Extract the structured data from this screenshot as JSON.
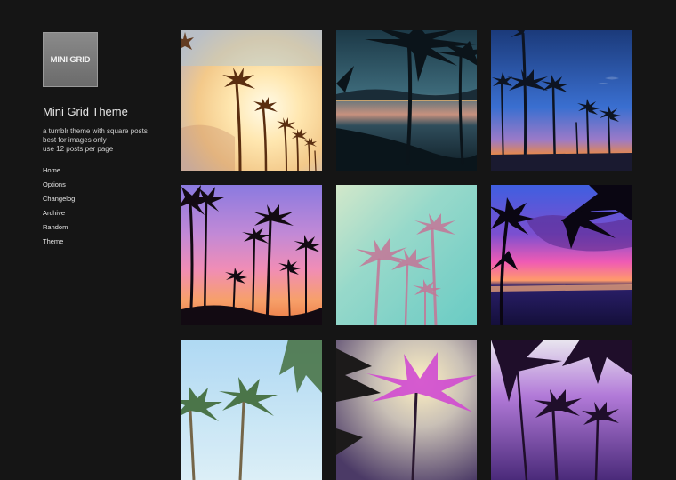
{
  "sidebar": {
    "logo_text": "MINI GRID",
    "title": "Mini Grid Theme",
    "description": [
      "a tumblr theme with square posts",
      "best for images only",
      "use 12 posts per page"
    ],
    "nav": [
      "Home",
      "Options",
      "Changelog",
      "Archive",
      "Random",
      "Theme"
    ]
  },
  "posts": [
    {
      "name": "photo-palm-sunburst"
    },
    {
      "name": "photo-palm-beach-night"
    },
    {
      "name": "photo-palm-blue-sunset"
    },
    {
      "name": "photo-palm-pink-sunset"
    },
    {
      "name": "photo-palm-teal-haze"
    },
    {
      "name": "photo-palm-ocean-sunset"
    },
    {
      "name": "photo-palm-sky-blue"
    },
    {
      "name": "photo-palm-purple-frond"
    },
    {
      "name": "photo-palm-purple-dusk"
    }
  ],
  "colors": {
    "background": "#151515",
    "text": "#e6e6e6"
  }
}
